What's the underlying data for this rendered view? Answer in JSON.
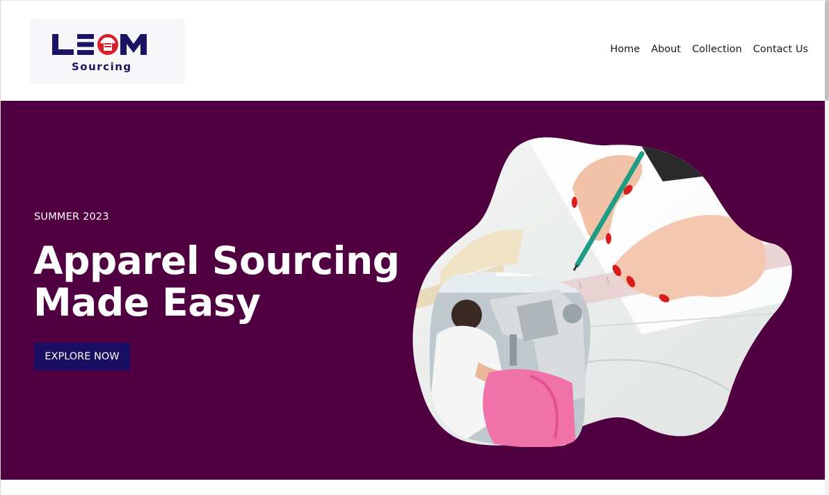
{
  "header": {
    "logo": {
      "word": "LEOM",
      "sub": "Sourcing"
    },
    "nav": [
      {
        "label": "Home"
      },
      {
        "label": "About"
      },
      {
        "label": "Collection"
      },
      {
        "label": "Contact Us"
      }
    ]
  },
  "hero": {
    "eyebrow": "SUMMER 2023",
    "headline_line1": "Apparel Sourcing",
    "headline_line2": "Made Easy",
    "cta_label": "EXPLORE NOW",
    "background_color": "#500040",
    "cta_color": "#190e62"
  },
  "brand": {
    "logo_navy": "#1b1466",
    "logo_red": "#d8202a"
  },
  "icons": {
    "shirt": "shirt-icon"
  }
}
